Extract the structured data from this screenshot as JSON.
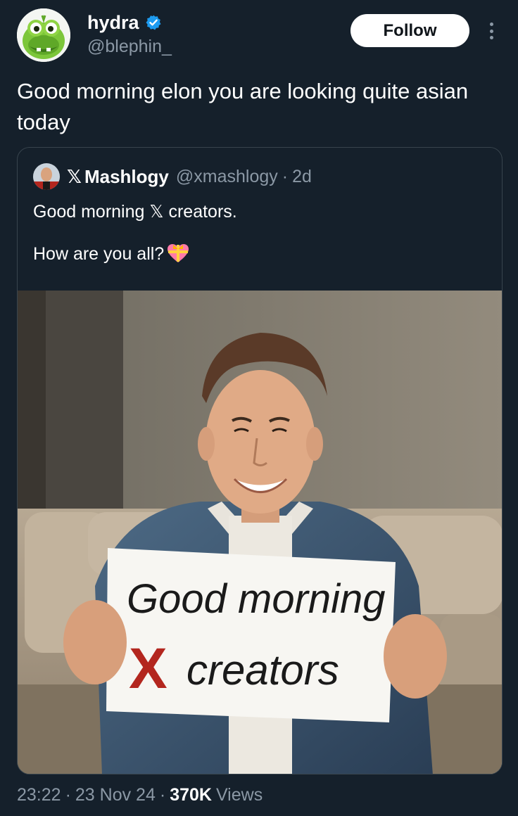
{
  "tweet": {
    "author": {
      "display_name": "hydra",
      "handle": "@blephin_",
      "verified": true,
      "avatar_icon": "om-nom-avatar"
    },
    "follow_label": "Follow",
    "more_icon": "more-dots-icon",
    "text": "Good morning elon you are looking quite asian today"
  },
  "quote": {
    "author": {
      "display_name": "Mashlogy",
      "name_prefix_logo": "𝕏",
      "handle": "@xmashlogy",
      "time": "2d"
    },
    "text_line1_prefix": "Good morning ",
    "text_line1_logo": "𝕏",
    "text_line1_suffix": " creators.",
    "text_line2": "How are you all?",
    "emoji_icon": "heart-with-ribbon-icon",
    "image": {
      "sign_line1": "Good morning",
      "sign_line2_logo": "X",
      "sign_line2": "creators"
    }
  },
  "meta": {
    "time": "23:22",
    "date": "23 Nov 24",
    "separator": "·",
    "views_count": "370K",
    "views_label": "Views"
  },
  "colors": {
    "background": "#15202b",
    "secondary_text": "#8b98a5",
    "verified_blue": "#1d9bf0",
    "border": "#38444d"
  }
}
